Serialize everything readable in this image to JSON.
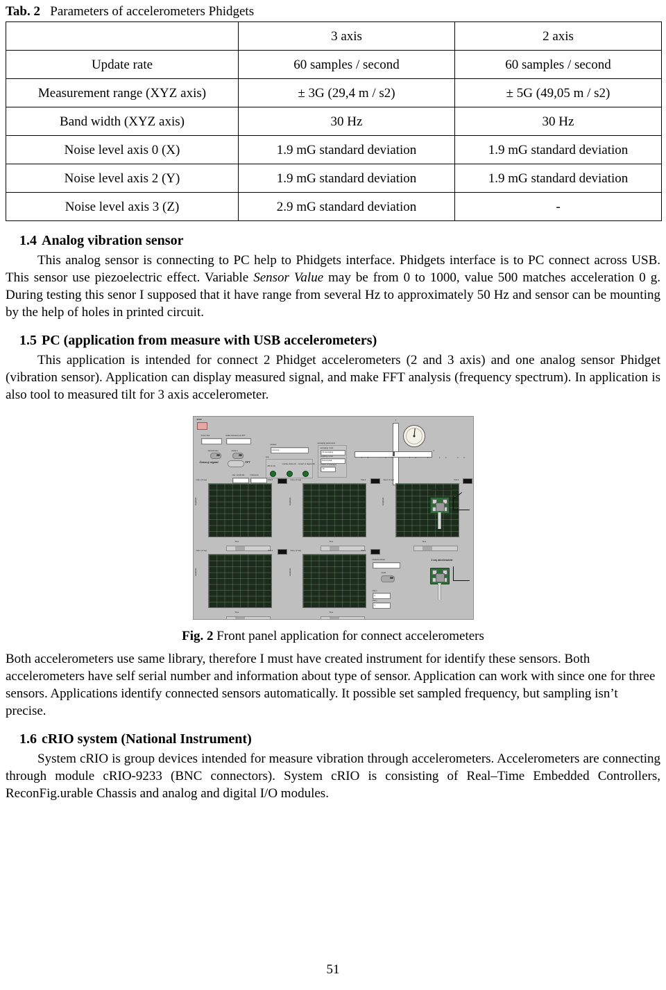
{
  "table": {
    "caption_lead": "Tab. 2",
    "caption_text": "Parameters of accelerometers Phidgets",
    "columns": [
      "",
      "3 axis",
      "2 axis"
    ],
    "rows": [
      [
        "Update rate",
        "60 samples / second",
        "60 samples / second"
      ],
      [
        "Measurement range (XYZ axis)",
        "± 3G (29,4 m / s2)",
        "± 5G (49,05 m / s2)"
      ],
      [
        "Band width (XYZ axis)",
        "30 Hz",
        "30 Hz"
      ],
      [
        "Noise level axis 0 (X)",
        "1.9 mG standard deviation",
        "1.9 mG standard deviation"
      ],
      [
        "Noise level axis 2 (Y)",
        "1.9 mG standard deviation",
        "1.9 mG standard deviation"
      ],
      [
        "Noise level axis 3 (Z)",
        "2.9 mG standard deviation",
        "-"
      ]
    ]
  },
  "section_14": {
    "number": "1.4",
    "title": "Analog vibration sensor",
    "para_part1": "This analog sensor is connecting to PC help to Phidgets interface. Phidgets interface is to PC connect across USB. This sensor use piezoelectric effect. Variable ",
    "para_italic": "Sensor Value",
    "para_part2": " may be from 0 to 1000, value 500 matches acceleration 0 g. During testing this senor I supposed that it have range from several Hz to approximately 50 Hz and sensor can be mounting by the help of holes in printed circuit."
  },
  "section_15": {
    "number": "1.5",
    "title": "PC (application from measure with USB accelerometers)",
    "para": "This application is intended for connect 2 Phidget accelerometers (2 and 3 axis) and one analog sensor Phidget (vibration sensor). Application can display measured signal, and make FFT analysis (frequency spectrum). In application is also tool to measured tilt for 3 axis accelerometer."
  },
  "figure": {
    "caption_lead": "Fig. 2",
    "caption_text": "Front panel application for connect accelerometers",
    "panel": {
      "stop_label": "STOP",
      "labels": {
        "vzork_frek": "Vzork. frek.",
        "delka_zaznamu": "Délka záznamu pro FFT",
        "vykresleni": "Vykreslování",
        "ulozeni": "Uložení",
        "casovy_signal": "Časový signál",
        "fft": "FFT",
        "window": "window",
        "window_value": "Hanning",
        "view": "view",
        "view_db": "dB On (F)",
        "view_unwrap": "unwrap phase (F)",
        "view_convert": "convert to degree (F)",
        "avg_params": "averaging parameters",
        "avg_mode_label": "averaging mode",
        "avg_mode_value": "No averaging",
        "weight_mode_label": "weighting mode",
        "weight_mode_value": "Exponential",
        "num_avg_label": "number of averages",
        "num_avg_value": "10",
        "max_amplitude": "max. amplitude",
        "frekvence": "Frekvence",
        "plot0": "Plot 0",
        "tilt_x": "X",
        "tilt_y": "Y",
        "sensor_3axis": "3 osy akcelerometr",
        "sensor_2axis": "2 osy akcelerometr",
        "vibration_reading": "Hodnota vibrací",
        "ulozit": "Uložit",
        "uhel_x": "úhel x",
        "uhel_y": "úhel y",
        "zero_value": "0"
      },
      "graph_titles": [
        "Osa x (3 osy)",
        "Osa y (3 osy)",
        "Osa z (3 osy)",
        "Osa x (2 osy)",
        "Osa y (2 osy)"
      ],
      "graph_axis_label_y": "Amplitude",
      "graph_axis_label_x": "Time",
      "graph_x_ticks": [
        "0",
        "2000",
        "4000",
        "6000",
        "8000",
        "10000",
        "12000",
        "14000"
      ],
      "graph1_y_ticks": [
        "-0,32",
        "-0,34",
        "-0,36",
        "-0,38",
        "-0,4",
        "-0,42",
        "-0,44",
        "-0,46"
      ],
      "graph2_y_ticks": [
        "0,08",
        "0,06",
        "0,04",
        "0,02",
        "0",
        "-0,02",
        "-0,04",
        "-0,06"
      ],
      "graph3_y_ticks": [
        "10,14",
        "10,12",
        "10,1",
        "10,08",
        "10,06",
        "10,04",
        "10,02",
        "10",
        "9,98",
        "9,96"
      ],
      "graph4_y_ticks": [
        "9,97",
        "9,96",
        "9,95",
        "9,94",
        "9,93",
        "9,92",
        "9,91",
        "9,9",
        "9,89",
        "9,88",
        "9,87",
        "9,86"
      ],
      "graph5_y_ticks": [
        "-0,13",
        "-0,14",
        "-0,15",
        "-0,16",
        "-0,17",
        "-0,18",
        "-0,19",
        "-0,2"
      ],
      "tilt_scale_x": [
        "-30",
        "-20",
        "-10",
        "0",
        "10",
        "20",
        "30"
      ],
      "tilt_scale_y": [
        "30",
        "20",
        "10",
        "0",
        "-10",
        "-20",
        "-30"
      ]
    }
  },
  "para_after_fig": "Both accelerometers use same library, therefore I must have created instrument for identify these sensors. Both accelerometers have self serial number and information about type of sensor. Application can work with since one for three sensors. Applications identify connected sensors automatically. It possible set sampled frequency, but sampling isn’t precise.",
  "section_16": {
    "number": "1.6",
    "title": "cRIO system (National Instrument)",
    "para": "System cRIO is group devices intended for measure vibration through accelerometers. Accelerometers are connecting through module cRIO-9233 (BNC connectors). System cRIO is consisting of Real–Time Embedded Controllers, ReconFig.urable Chassis and analog and digital I/O modules."
  },
  "page_number": "51"
}
